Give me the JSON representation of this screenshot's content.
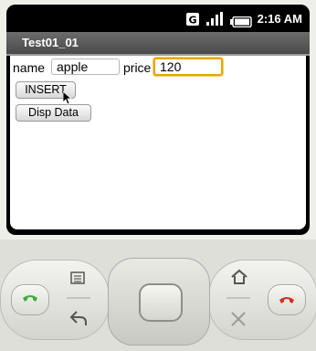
{
  "status_bar": {
    "network_label": "G",
    "time": "2:16 AM",
    "icons": [
      "g-network-icon",
      "signal-icon",
      "battery-icon"
    ]
  },
  "app": {
    "title": "Test01_01"
  },
  "form": {
    "name_label": "name",
    "name_value": "apple",
    "price_label": "price",
    "price_value": "120",
    "insert_label": "INSERT",
    "disp_label": "Disp Data"
  },
  "hardware_keys": [
    "call-icon",
    "menu-icon",
    "back-icon",
    "home-icon",
    "search-icon",
    "end-call-icon"
  ],
  "colors": {
    "focus_border": "#e8a400",
    "title_bar": "#555555",
    "call_green": "#3cae3c",
    "end_red": "#d03020"
  }
}
